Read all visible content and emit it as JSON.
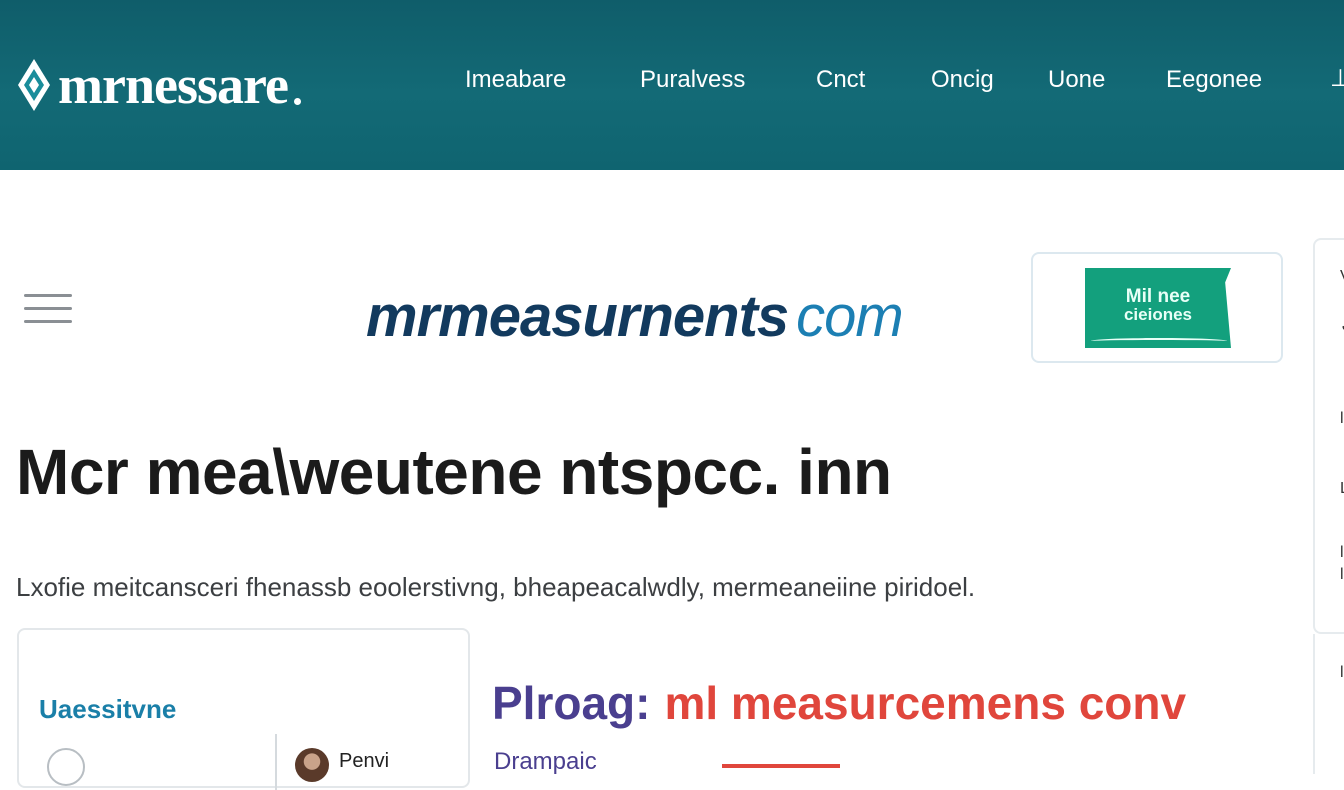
{
  "header": {
    "brand": "mrnessare",
    "nav": [
      "Imeabare",
      "Puralvess",
      "Cnct",
      "Oncig",
      "Uone",
      "Eegonee"
    ],
    "bg_color": "#136a76"
  },
  "hero": {
    "domain_main": "mrmeasurnents",
    "domain_tld": "com",
    "badge_line1": "Mil nee",
    "badge_line2": "cieiones",
    "badge_color": "#13a07d"
  },
  "content": {
    "headline": "Mcr mea\\weutene ntspcc. inn",
    "subline": "Lxofie meitcansceri fhenassb eoolerstivng, bheapeacalwdly, mermeaneiine piridoel."
  },
  "card": {
    "title": "Uaessitvne",
    "person_name": "Penvi"
  },
  "promo": {
    "lead": "Plroag:",
    "accent": "ml measurcemens conv",
    "sub": "Drampaic",
    "accent_color": "#e0463c"
  }
}
